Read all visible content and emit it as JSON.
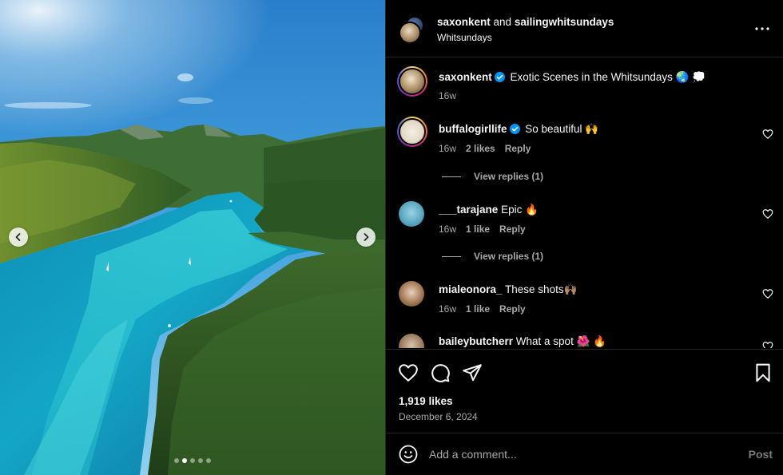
{
  "header": {
    "username": "saxonkent",
    "connector": " and ",
    "collaborator": "sailingwhitsundays",
    "location": "Whitsundays"
  },
  "caption": {
    "username": "saxonkent",
    "text": " Exotic Scenes in the Whitsundays 🌏 💭",
    "time": "16w"
  },
  "comments": [
    {
      "username": "buffalogirllife",
      "verified": true,
      "text": " So beautiful 🙌",
      "time": "16w",
      "likes": "2 likes",
      "reply": "Reply",
      "view_replies": "View replies (1)"
    },
    {
      "username": "___tarajane",
      "verified": false,
      "text": " Epic 🔥",
      "time": "16w",
      "likes": "1 like",
      "reply": "Reply",
      "view_replies": "View replies (1)"
    },
    {
      "username": "mialeonora_",
      "verified": false,
      "text": " These shots🙌🏽",
      "time": "16w",
      "likes": "1 like",
      "reply": "Reply"
    },
    {
      "username": "baileybutcherr",
      "verified": false,
      "text": " What a spot 🌺 🔥"
    }
  ],
  "post": {
    "likes": "1,919 likes",
    "date": "December 6, 2024"
  },
  "composer": {
    "placeholder": "Add a comment...",
    "post_label": "Post"
  },
  "carousel": {
    "slide_count": 5,
    "active_index": 1
  },
  "colors": {
    "background": "#000000",
    "text": "#f5f5f5",
    "secondary": "#a8a8a8",
    "verified": "#0095f6",
    "border": "#262626"
  },
  "icons": [
    "chevron-left-icon",
    "chevron-right-icon",
    "more-icon",
    "verified-icon",
    "heart-icon",
    "comment-icon",
    "share-icon",
    "bookmark-icon",
    "emoji-icon"
  ]
}
